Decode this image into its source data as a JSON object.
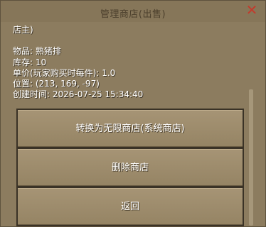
{
  "window": {
    "title": "管理商店(出售)",
    "close_icon": "close-icon"
  },
  "info": {
    "owner": "店主)",
    "item": "物品: 熟猪排",
    "stock": "库存: 10",
    "price": "单价(玩家购买时每件): 1.0",
    "position": "位置: (213, 169, -97)",
    "created": "创建时间: 2026-07-25 15:34:40"
  },
  "buttons": {
    "convert": "转换为无限商店(系统商店)",
    "delete": "删除商店",
    "back": "返回"
  }
}
